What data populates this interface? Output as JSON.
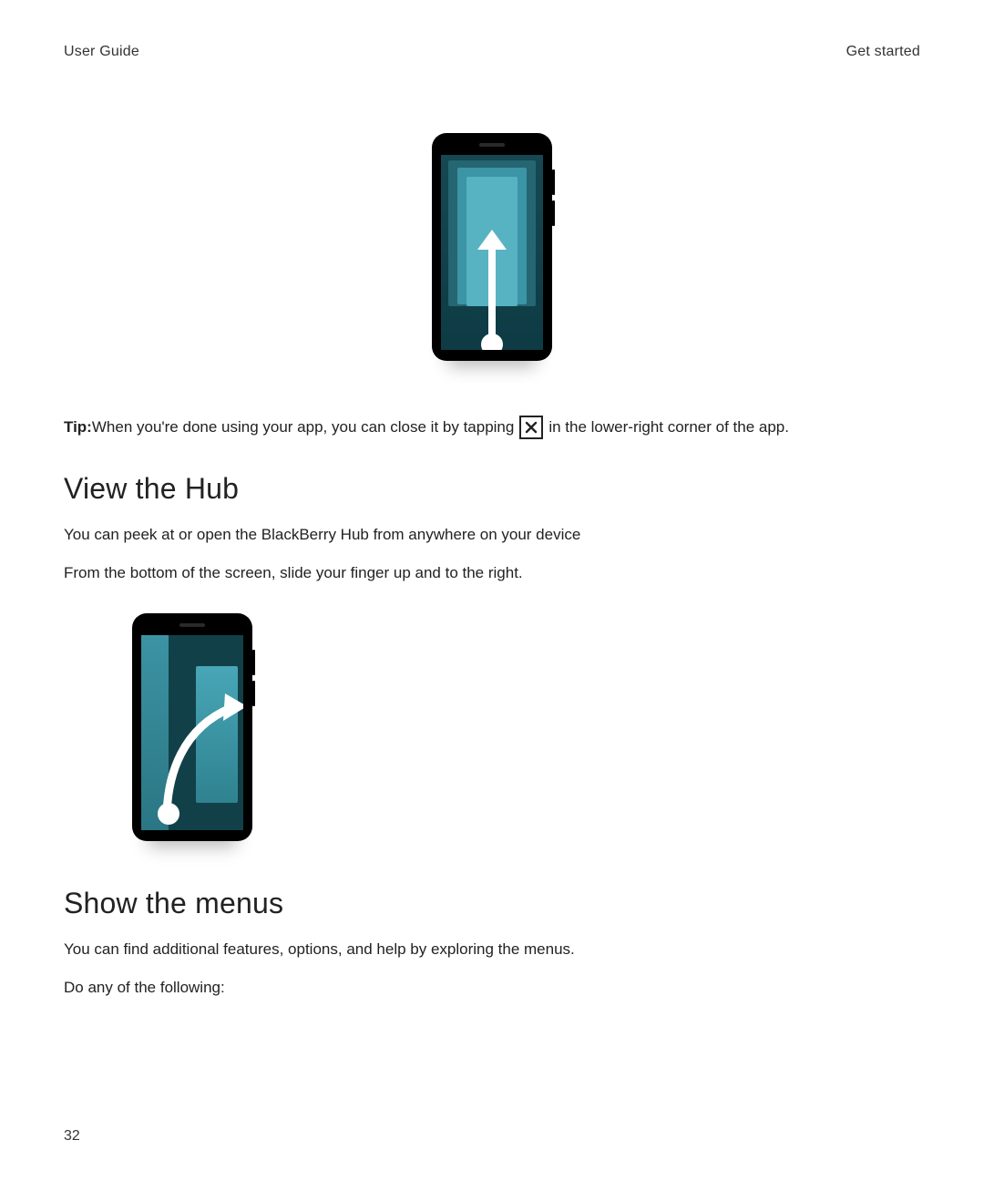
{
  "header": {
    "left": "User Guide",
    "right": "Get started"
  },
  "tip": {
    "label": "Tip:",
    "before_icon": " When you're done using your app, you can close it by tapping ",
    "after_icon": " in the lower-right corner of the app."
  },
  "icons": {
    "close": "close-icon"
  },
  "sections": {
    "view_hub": {
      "heading": "View the Hub",
      "p1": "You can peek at or open the BlackBerry Hub from anywhere on your device",
      "p2": "From the bottom of the screen, slide your finger up and to the right."
    },
    "show_menus": {
      "heading": "Show the menus",
      "p1": "You can find additional features, options, and help by exploring the menus.",
      "p2": "Do any of the following:"
    }
  },
  "page_number": "32"
}
